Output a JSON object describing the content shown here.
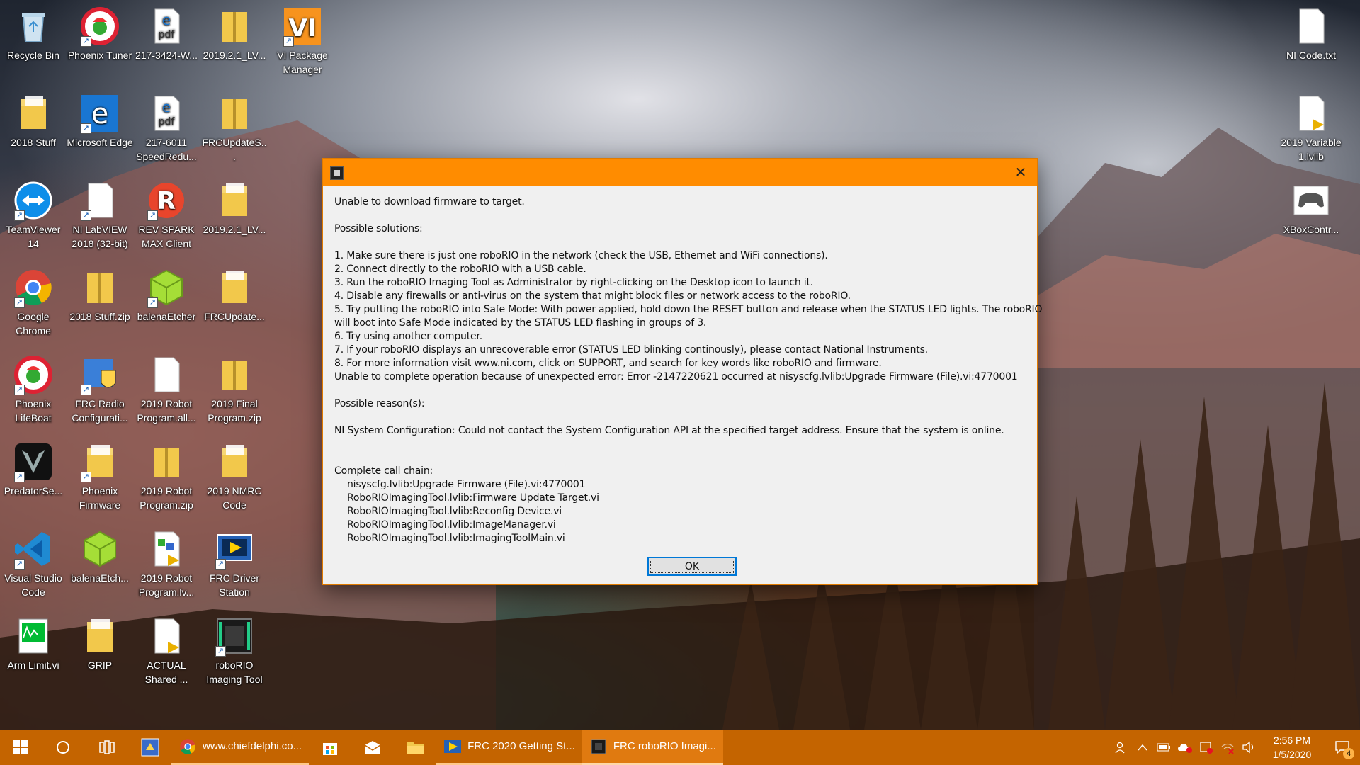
{
  "desktop": {
    "icons": [
      {
        "label": "Recycle Bin",
        "icon": "recycle-bin-icon"
      },
      {
        "label": "Phoenix Tuner",
        "icon": "phoenix-icon"
      },
      {
        "label": "217-3424-W...",
        "icon": "pdf-icon"
      },
      {
        "label": "2019.2.1_LV...",
        "icon": "zip-folder-icon"
      },
      {
        "label": "VI Package Manager",
        "icon": "vi-package-icon"
      },
      {
        "label": "2018 Stuff",
        "icon": "folder-icon"
      },
      {
        "label": "Microsoft Edge",
        "icon": "edge-icon"
      },
      {
        "label": "217-6011 SpeedRedu...",
        "icon": "pdf-icon"
      },
      {
        "label": "FRCUpdateS...",
        "icon": "zip-folder-icon"
      },
      {
        "label": "TeamViewer 14",
        "icon": "teamviewer-icon"
      },
      {
        "label": "NI LabVIEW 2018 (32-bit)",
        "icon": "file-icon"
      },
      {
        "label": "REV SPARK MAX Client",
        "icon": "rev-icon"
      },
      {
        "label": "2019.2.1_LV...",
        "icon": "folder-icon"
      },
      {
        "label": "Google Chrome",
        "icon": "chrome-icon"
      },
      {
        "label": "2018 Stuff.zip",
        "icon": "zip-folder-icon"
      },
      {
        "label": "balenaEtcher",
        "icon": "balena-icon"
      },
      {
        "label": "FRCUpdate...",
        "icon": "folder-icon"
      },
      {
        "label": "Phoenix LifeBoat",
        "icon": "phoenix-icon"
      },
      {
        "label": "FRC Radio Configurati...",
        "icon": "radio-config-icon"
      },
      {
        "label": "2019 Robot Program.all...",
        "icon": "file-icon"
      },
      {
        "label": "2019 Final Program.zip",
        "icon": "zip-folder-icon"
      },
      {
        "label": "PredatorSe...",
        "icon": "predator-icon"
      },
      {
        "label": "Phoenix Firmware",
        "icon": "folder-icon"
      },
      {
        "label": "2019 Robot Program.zip",
        "icon": "zip-folder-icon"
      },
      {
        "label": "2019 NMRC Code",
        "icon": "folder-icon"
      },
      {
        "label": "Visual Studio Code",
        "icon": "vscode-icon"
      },
      {
        "label": "balenaEtch...",
        "icon": "balena-icon"
      },
      {
        "label": "2019 Robot Program.lv...",
        "icon": "labview-project-icon"
      },
      {
        "label": "FRC Driver Station",
        "icon": "driver-station-icon"
      },
      {
        "label": "Arm Limit.vi",
        "icon": "vi-file-icon"
      },
      {
        "label": "GRIP",
        "icon": "folder-icon"
      },
      {
        "label": "ACTUAL Shared ...",
        "icon": "lvlib-icon"
      },
      {
        "label": "roboRIO Imaging Tool",
        "icon": "roborio-icon"
      },
      {
        "label": "NI Code.txt",
        "icon": "text-file-icon"
      },
      {
        "label": "2019 Variable 1.lvlib",
        "icon": "lvlib-icon"
      },
      {
        "label": "XBoxContr...",
        "icon": "controller-icon"
      }
    ]
  },
  "dialog": {
    "title": "",
    "message": "Unable to download firmware to target.",
    "solutions_heading": "Possible solutions:",
    "solutions": [
      "1. Make sure there is just one roboRIO in the network (check the USB, Ethernet and WiFi connections).",
      "2. Connect directly to the roboRIO with a USB cable.",
      "3. Run the roboRIO Imaging Tool as Administrator by right-clicking on the Desktop icon to launch it.",
      "4. Disable any firewalls or anti-virus on the system that might block files or network access to the roboRIO.",
      "5. Try putting the roboRIO into Safe Mode: With power applied, hold down the RESET button and release when the STATUS LED lights. The roboRIO",
      "will boot into Safe Mode indicated by the STATUS LED flashing in groups of 3.",
      "6. Try using another computer.",
      "7. If your roboRIO displays an unrecoverable error (STATUS LED blinking continously), please contact National Instruments.",
      "8. For more information visit  www.ni.com, click on SUPPORT, and search for key words like roboRIO and firmware.",
      "Unable to complete operation because of unexpected error: Error -2147220621 occurred at nisyscfg.lvlib:Upgrade Firmware (File).vi:4770001"
    ],
    "reasons_heading": "Possible reason(s):",
    "reason": "NI System Configuration: Could not contact the System Configuration API at the specified target address. Ensure that the system is online.",
    "call_chain_heading": "Complete call chain:",
    "call_chain": [
      "nisyscfg.lvlib:Upgrade Firmware (File).vi:4770001",
      "RoboRIOImagingTool.lvlib:Firmware Update Target.vi",
      "RoboRIOImagingTool.lvlib:Reconfig Device.vi",
      "RoboRIOImagingTool.lvlib:ImageManager.vi",
      "RoboRIOImagingTool.lvlib:ImagingToolMain.vi"
    ],
    "ok_label": "OK",
    "close_glyph": "✕"
  },
  "taskbar": {
    "tasks": [
      {
        "label": "www.chiefdelphi.co...",
        "icon": "chrome-icon"
      },
      {
        "label": "FRC 2020 Getting St...",
        "icon": "labview-project-icon"
      },
      {
        "label": "FRC roboRIO Imagi...",
        "icon": "roborio-icon"
      }
    ],
    "clock_time": "2:56 PM",
    "clock_date": "1/5/2020",
    "notification_count": "4"
  },
  "colors": {
    "accent": "#ff8c00",
    "taskbar": "#c46400",
    "ok_border": "#0078d7"
  }
}
